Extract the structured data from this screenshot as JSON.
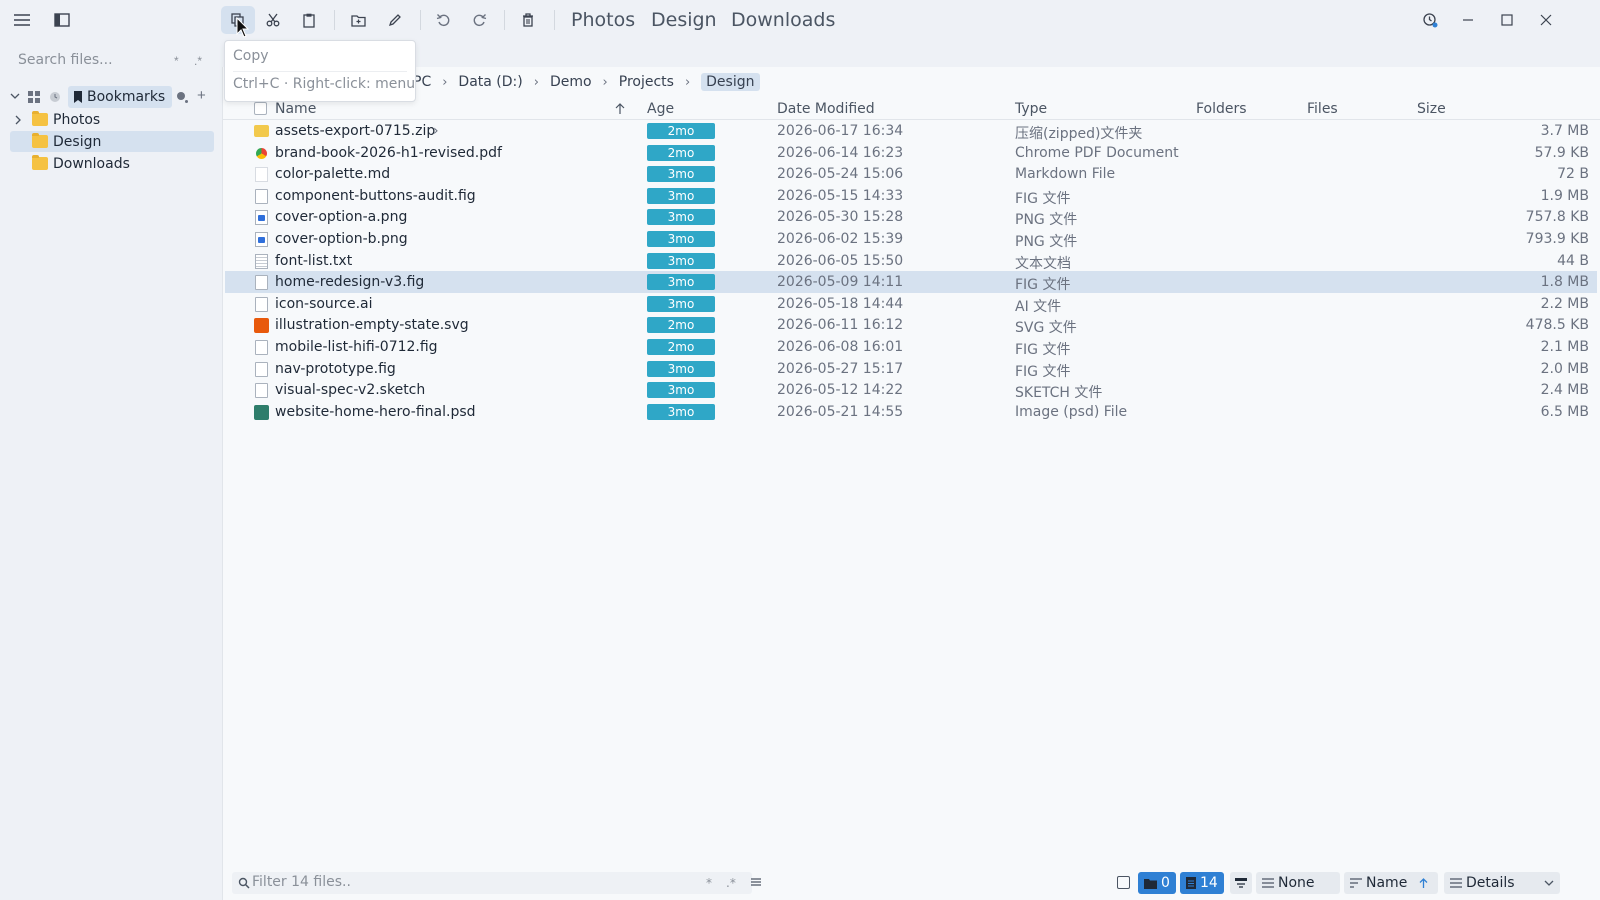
{
  "toolbar": {
    "tabs": [
      "Photos",
      "Design",
      "Downloads"
    ],
    "icons": [
      "menu-icon",
      "sidebar-toggle-icon",
      "copy-icon",
      "cut-icon",
      "paste-icon",
      "new-folder-icon",
      "rename-icon",
      "undo-icon",
      "redo-icon",
      "delete-icon",
      "history-icon",
      "minimize-icon",
      "maximize-icon",
      "close-icon"
    ]
  },
  "tooltip": {
    "title": "Copy",
    "hint": "Ctrl+C · Right-click: menu"
  },
  "sidebar": {
    "search_placeholder": "Search files...",
    "search_opt_wild": "*",
    "search_opt_regex": ".*",
    "bookmarks_label": "Bookmarks",
    "add_label": "+",
    "items": [
      {
        "label": "Photos"
      },
      {
        "label": "Design"
      },
      {
        "label": "Downloads"
      }
    ]
  },
  "breadcrumb": {
    "parts": [
      "PC",
      "Data (D:)",
      "Demo",
      "Projects"
    ],
    "current": "Design"
  },
  "columns": {
    "name": "Name",
    "age": "Age",
    "date": "Date Modified",
    "type": "Type",
    "folders": "Folders",
    "files": "Files",
    "size": "Size"
  },
  "files": [
    {
      "name": "assets-export-0715.zip",
      "age": "2mo",
      "date": "2026-06-17 16:34",
      "type": "压缩(zipped)文件夹",
      "size": "3.7 MB",
      "icon": "zip-icon"
    },
    {
      "name": "brand-book-2026-h1-revised.pdf",
      "age": "2mo",
      "date": "2026-06-14 16:23",
      "type": "Chrome PDF Document",
      "size": "57.9 KB",
      "icon": "pdf-icon"
    },
    {
      "name": "color-palette.md",
      "age": "3mo",
      "date": "2026-05-24 15:06",
      "type": "Markdown File",
      "size": "72 B",
      "icon": "markdown-icon"
    },
    {
      "name": "component-buttons-audit.fig",
      "age": "3mo",
      "date": "2026-05-15 14:33",
      "type": "FIG 文件",
      "size": "1.9 MB",
      "icon": "file-icon"
    },
    {
      "name": "cover-option-a.png",
      "age": "3mo",
      "date": "2026-05-30 15:28",
      "type": "PNG 文件",
      "size": "757.8 KB",
      "icon": "image-icon"
    },
    {
      "name": "cover-option-b.png",
      "age": "3mo",
      "date": "2026-06-02 15:39",
      "type": "PNG 文件",
      "size": "793.9 KB",
      "icon": "image-icon"
    },
    {
      "name": "font-list.txt",
      "age": "3mo",
      "date": "2026-06-05 15:50",
      "type": "文本文档",
      "size": "44 B",
      "icon": "text-icon"
    },
    {
      "name": "home-redesign-v3.fig",
      "age": "3mo",
      "date": "2026-05-09 14:11",
      "type": "FIG 文件",
      "size": "1.8 MB",
      "icon": "file-icon",
      "selected": true
    },
    {
      "name": "icon-source.ai",
      "age": "3mo",
      "date": "2026-05-18 14:44",
      "type": "AI 文件",
      "size": "2.2 MB",
      "icon": "file-icon"
    },
    {
      "name": "illustration-empty-state.svg",
      "age": "2mo",
      "date": "2026-06-11 16:12",
      "type": "SVG 文件",
      "size": "478.5 KB",
      "icon": "svg-icon"
    },
    {
      "name": "mobile-list-hifi-0712.fig",
      "age": "2mo",
      "date": "2026-06-08 16:01",
      "type": "FIG 文件",
      "size": "2.1 MB",
      "icon": "file-icon"
    },
    {
      "name": "nav-prototype.fig",
      "age": "3mo",
      "date": "2026-05-27 15:17",
      "type": "FIG 文件",
      "size": "2.0 MB",
      "icon": "file-icon"
    },
    {
      "name": "visual-spec-v2.sketch",
      "age": "3mo",
      "date": "2026-05-12 14:22",
      "type": "SKETCH 文件",
      "size": "2.4 MB",
      "icon": "file-icon"
    },
    {
      "name": "website-home-hero-final.psd",
      "age": "3mo",
      "date": "2026-05-21 14:55",
      "type": "Image (psd) File",
      "size": "6.5 MB",
      "icon": "psd-icon"
    }
  ],
  "statusbar": {
    "filter_placeholder": "Filter 14 files..",
    "filter_opt_wild": "*",
    "filter_opt_regex": ".*",
    "folders_count": "0",
    "files_count": "14",
    "group_label": "None",
    "sort_label": "Name",
    "view_label": "Details"
  },
  "colors": {
    "accent": "#2f80d4",
    "age_badge": "#2fa7c7",
    "selection": "#d5e1ef"
  }
}
